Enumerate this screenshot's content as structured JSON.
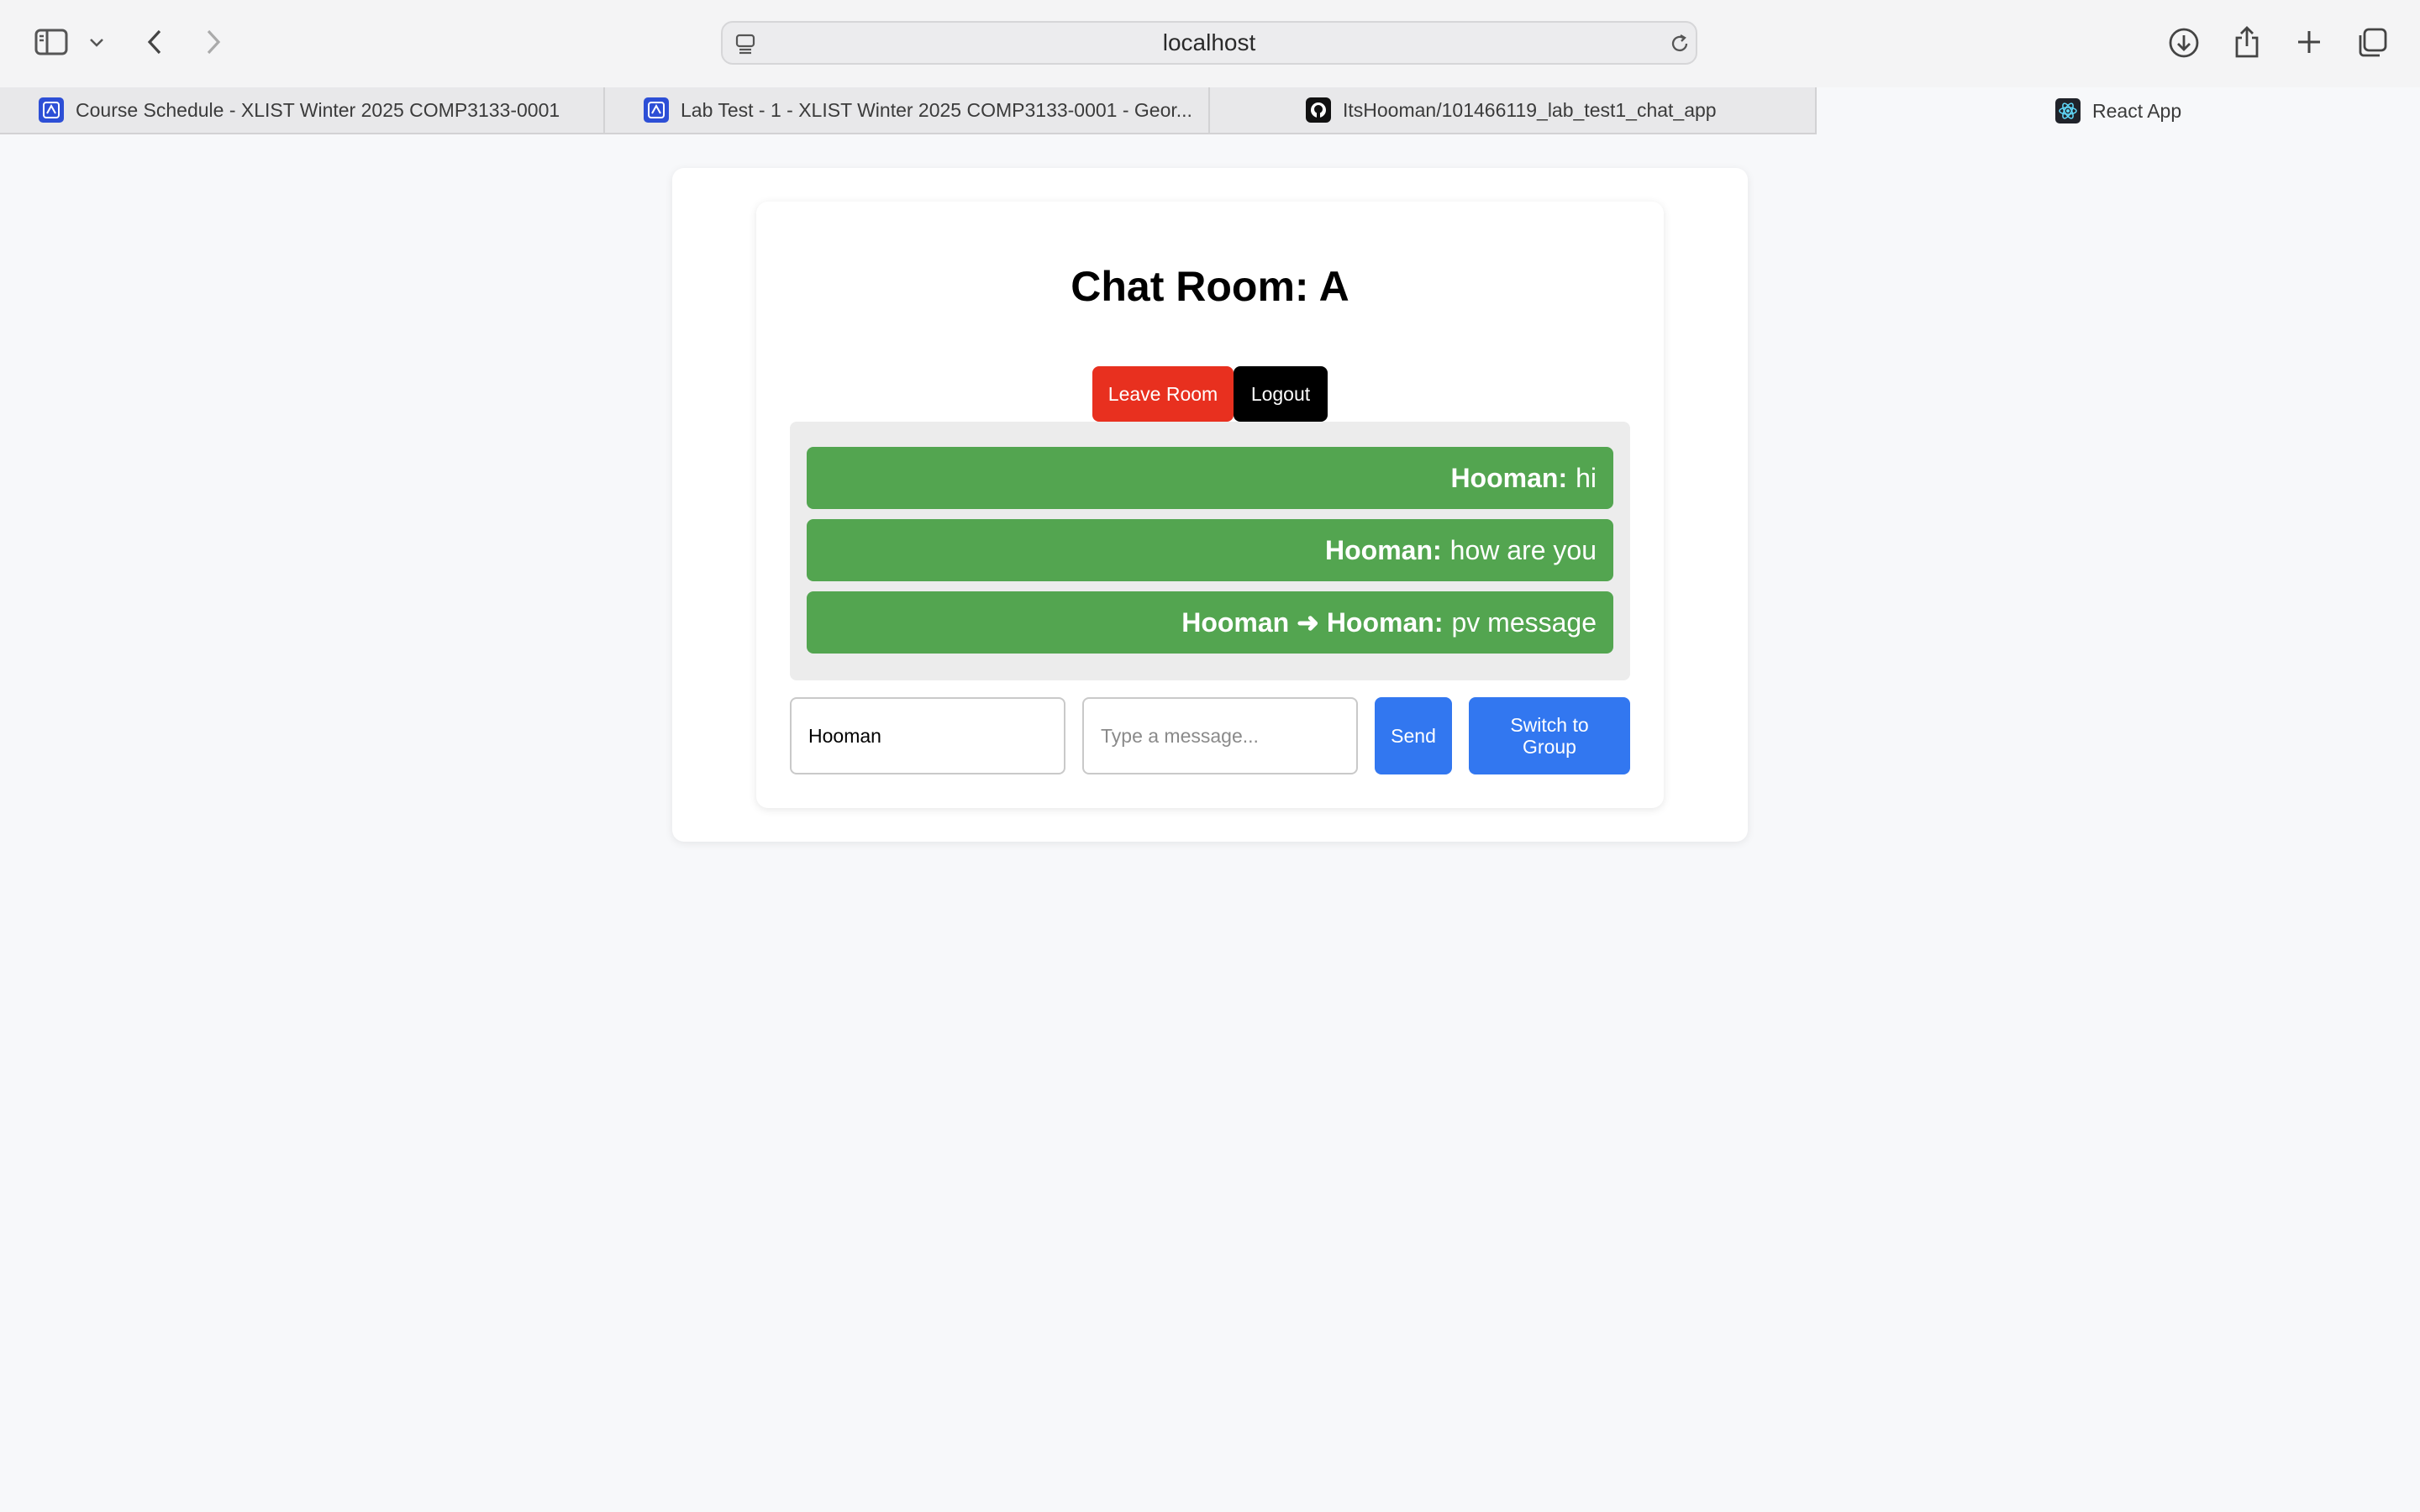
{
  "browser": {
    "address": "localhost",
    "tabs": [
      {
        "title": "Course Schedule - XLIST Winter 2025 COMP3133-0001",
        "icon": "college-logo-icon"
      },
      {
        "title": "Lab Test - 1 - XLIST Winter 2025 COMP3133-0001 - Geor...",
        "icon": "college-logo-icon"
      },
      {
        "title": "ItsHooman/101466119_lab_test1_chat_app",
        "icon": "github-icon"
      },
      {
        "title": "React App",
        "icon": "react-icon"
      }
    ]
  },
  "chat": {
    "title": "Chat Room: A",
    "leave_label": "Leave Room",
    "logout_label": "Logout",
    "messages": [
      {
        "sender": "Hooman:",
        "text": "hi"
      },
      {
        "sender": "Hooman:",
        "text": "how are you"
      },
      {
        "sender": "Hooman ➜ Hooman:",
        "text": "pv message"
      }
    ],
    "recipient_value": "Hooman",
    "message_placeholder": "Type a message...",
    "send_label": "Send",
    "switch_label": "Switch to Group"
  },
  "colors": {
    "leave": "#e8301f",
    "logout": "#000000",
    "message_bg": "#53a550",
    "primary": "#3277f0"
  }
}
